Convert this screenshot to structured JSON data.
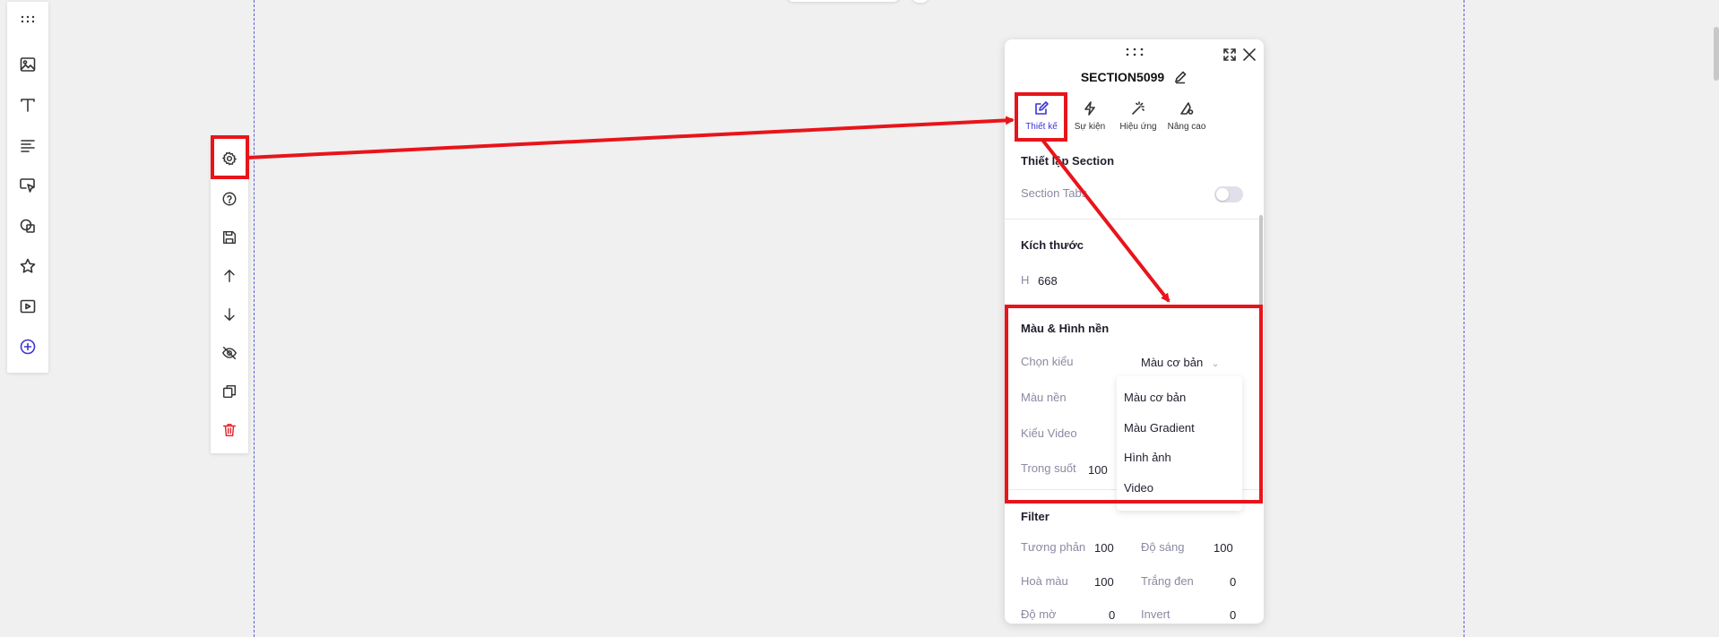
{
  "panel": {
    "title": "SECTION5099",
    "tabs": [
      {
        "label": "Thiết kế",
        "icon": "edit-icon",
        "active": true
      },
      {
        "label": "Sự kiện",
        "icon": "lightning-icon",
        "active": false
      },
      {
        "label": "Hiệu ứng",
        "icon": "magic-wand-icon",
        "active": false
      },
      {
        "label": "Nâng cao",
        "icon": "advanced-icon",
        "active": false
      }
    ],
    "section_settings": {
      "heading": "Thiết lập Section",
      "tabs_label": "Section Tabs",
      "tabs_enabled": false
    },
    "size": {
      "heading": "Kích thước",
      "h_label": "H",
      "h_value": "668"
    },
    "background": {
      "heading": "Màu & Hình nền",
      "type_label": "Chọn kiểu",
      "type_value": "Màu cơ bản",
      "color_label": "Màu nền",
      "video_label": "Kiểu Video",
      "opacity_label": "Trong suốt",
      "opacity_value": "100",
      "options": [
        "Màu cơ bản",
        "Màu Gradient",
        "Hình ảnh",
        "Video"
      ]
    },
    "filter": {
      "heading": "Filter",
      "contrast_label": "Tương phản",
      "contrast_value": "100",
      "brightness_label": "Độ sáng",
      "brightness_value": "100",
      "hue_label": "Hoà màu",
      "hue_value": "100",
      "grayscale_label": "Trắng đen",
      "grayscale_value": "0",
      "blur_label": "Độ mờ",
      "blur_value": "0",
      "invert_label": "Invert",
      "invert_value": "0"
    }
  },
  "left_toolbar": {
    "items": [
      "drag-handle-icon",
      "image-icon",
      "text-icon",
      "paragraph-icon",
      "cursor-icon",
      "shapes-icon",
      "star-icon",
      "video-icon",
      "add-circle-icon"
    ]
  },
  "section_toolbar": {
    "items": [
      "gear-icon",
      "help-icon",
      "save-icon",
      "arrow-up-icon",
      "arrow-down-icon",
      "eye-off-icon",
      "duplicate-icon",
      "trash-icon"
    ]
  },
  "colors": {
    "accent": "#3c34d4",
    "annotation": "#e8141b",
    "delete": "#e0242c",
    "canvas": "#f0f0f0"
  }
}
